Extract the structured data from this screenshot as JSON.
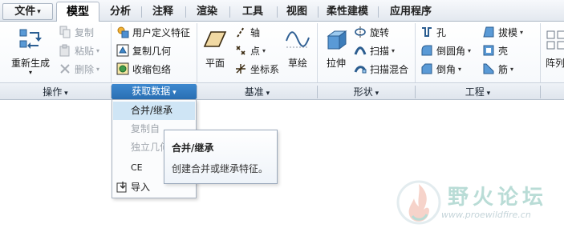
{
  "tabs": [
    {
      "label": "文件"
    },
    {
      "label": "模型"
    },
    {
      "label": "分析"
    },
    {
      "label": "注释"
    },
    {
      "label": "渲染"
    },
    {
      "label": "工具"
    },
    {
      "label": "视图"
    },
    {
      "label": "柔性建模"
    },
    {
      "label": "应用程序"
    }
  ],
  "operations": {
    "regenerate": "重新生成",
    "copy": "复制",
    "paste": "粘贴",
    "delete": "删除",
    "group_label": "操作"
  },
  "get_data": {
    "udf": "用户定义特征",
    "copy_geometry": "复制几何",
    "shrinkwrap": "收缩包络",
    "group_label": "获取数据"
  },
  "datum": {
    "plane": "平面",
    "axis": "轴",
    "point": "点",
    "csys": "坐标系",
    "sketch": "草绘",
    "group_label": "基准"
  },
  "shapes": {
    "extrude": "拉伸",
    "revolve": "旋转",
    "sweep": "扫描",
    "swept_blend": "扫描混合",
    "group_label": "形状"
  },
  "engineering": {
    "hole": "孔",
    "round": "倒圆角",
    "chamfer": "倒角",
    "draft": "拔模",
    "shell": "壳",
    "rib": "筋",
    "pattern": "阵列",
    "group_label": "工程"
  },
  "dropdown": [
    {
      "label": "合并/继承"
    },
    {
      "label": "复制自"
    },
    {
      "label": "独立几何"
    },
    {
      "label": "CE"
    },
    {
      "label": "导入"
    }
  ],
  "tooltip": {
    "title": "合并/继承",
    "description": "创建合并或继承特征。"
  },
  "watermark": {
    "text": "野火论坛",
    "url": "www.proewildfire.cn"
  },
  "colors": {
    "highlight": "#2f76bb",
    "menu_hover": "#cfe5f5"
  }
}
